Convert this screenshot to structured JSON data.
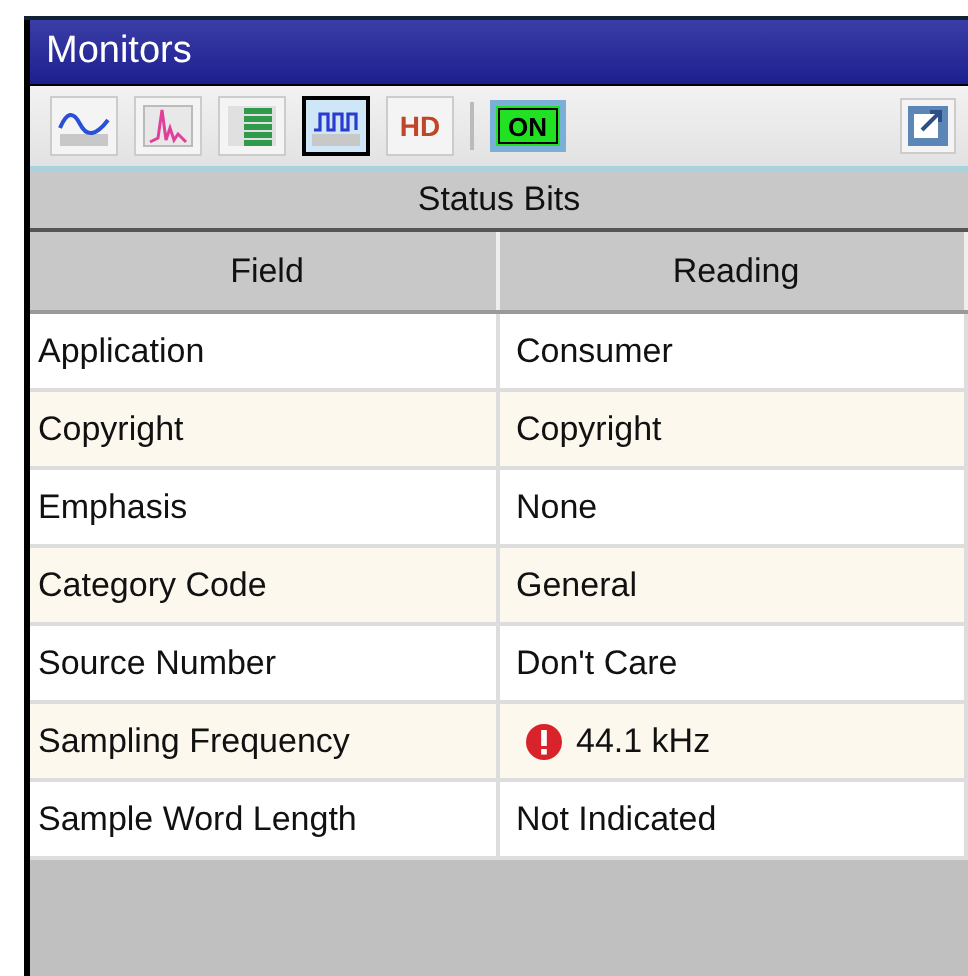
{
  "window": {
    "title": "Monitors"
  },
  "toolbar": {
    "buttons": [
      {
        "kind": "wave",
        "selected": false
      },
      {
        "kind": "spectrum",
        "selected": false
      },
      {
        "kind": "bars",
        "selected": false
      },
      {
        "kind": "pulse",
        "selected": true
      },
      {
        "kind": "text",
        "label": "HD",
        "selected": false
      }
    ],
    "toggle": {
      "label": "ON",
      "on": true
    }
  },
  "panel": {
    "title": "Status Bits"
  },
  "table": {
    "columns": [
      "Field",
      "Reading"
    ],
    "rows": [
      {
        "field": "Application",
        "reading": "Consumer",
        "alert": false
      },
      {
        "field": "Copyright",
        "reading": "Copyright",
        "alert": false
      },
      {
        "field": "Emphasis",
        "reading": "None",
        "alert": false
      },
      {
        "field": "Category Code",
        "reading": "General",
        "alert": false
      },
      {
        "field": "Source Number",
        "reading": "Don't Care",
        "alert": false
      },
      {
        "field": "Sampling Frequency",
        "reading": "44.1 kHz",
        "alert": true
      },
      {
        "field": "Sample Word Length",
        "reading": "Not Indicated",
        "alert": false
      }
    ]
  }
}
